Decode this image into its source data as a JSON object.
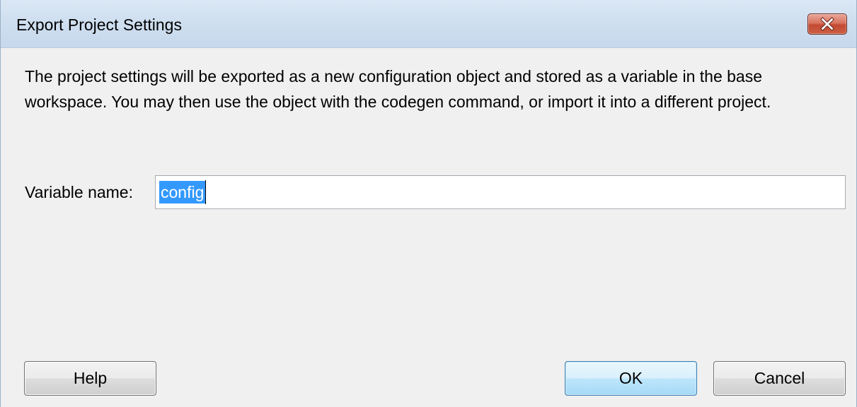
{
  "window": {
    "title": "Export Project Settings",
    "close_icon": "close-icon"
  },
  "description": "The project settings will be exported as a new configuration object and stored as a variable in the base workspace. You may then use the object with the codegen command, or import it into a different project.",
  "variable_name": {
    "label": "Variable name:",
    "value": "config",
    "selected": true
  },
  "buttons": {
    "help": "Help",
    "ok": "OK",
    "cancel": "Cancel"
  },
  "colors": {
    "selection_highlight": "#3399ff",
    "title_bar": "#cfdff0",
    "close_button": "#c24a32",
    "dialog_background": "#f0f0f0"
  }
}
